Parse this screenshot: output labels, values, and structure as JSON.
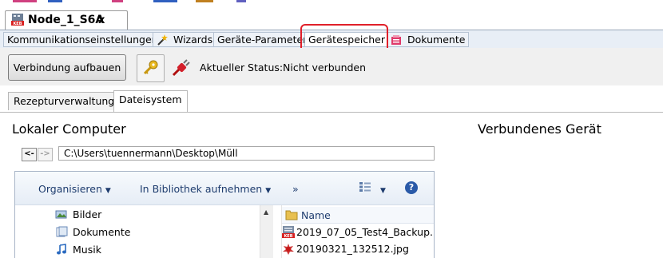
{
  "document_tab": {
    "title": "Node_1_S6A",
    "close": "x",
    "icon": "keb-device-icon"
  },
  "tabs": [
    {
      "label": "Kommunikationseinstellungen",
      "icon": null
    },
    {
      "label": "Wizards",
      "icon": "wand-icon"
    },
    {
      "label": "Geräte-Parameter",
      "icon": null
    },
    {
      "label": "Gerätespeicher",
      "icon": null,
      "active": true
    },
    {
      "label": "Dokumente",
      "icon": "documents-icon"
    }
  ],
  "toolbar": {
    "connect_label": "Verbindung aufbauen",
    "status_label": "Aktueller Status:",
    "status_value": "Nicht verbunden"
  },
  "subtabs": [
    {
      "label": "Rezepturverwaltung"
    },
    {
      "label": "Dateisystem",
      "active": true
    }
  ],
  "local": {
    "heading": "Lokaler Computer",
    "nav_back": "<-",
    "nav_forward": "->",
    "path": "C:\\Users\\tuennermann\\Desktop\\Müll"
  },
  "device": {
    "heading": "Verbundenes Gerät"
  },
  "explorer": {
    "toolbar": {
      "organize": "Organisieren",
      "library": "In Bibliothek aufnehmen",
      "more": "»"
    },
    "tree": [
      {
        "label": "Bilder",
        "icon": "pictures-icon"
      },
      {
        "label": "Dokumente",
        "icon": "documents-library-icon"
      },
      {
        "label": "Musik",
        "icon": "music-icon"
      }
    ],
    "files_header": "Name",
    "files": [
      {
        "name": "2019_07_05_Test4_Backup.",
        "icon": "keb-file-icon"
      },
      {
        "name": "20190321_132512.jpg",
        "icon": "image-file-icon"
      }
    ]
  },
  "colors": {
    "highlight": "#e0202a",
    "tab_bar": "#e8eef6",
    "explorer_text": "#1e3c6e"
  }
}
